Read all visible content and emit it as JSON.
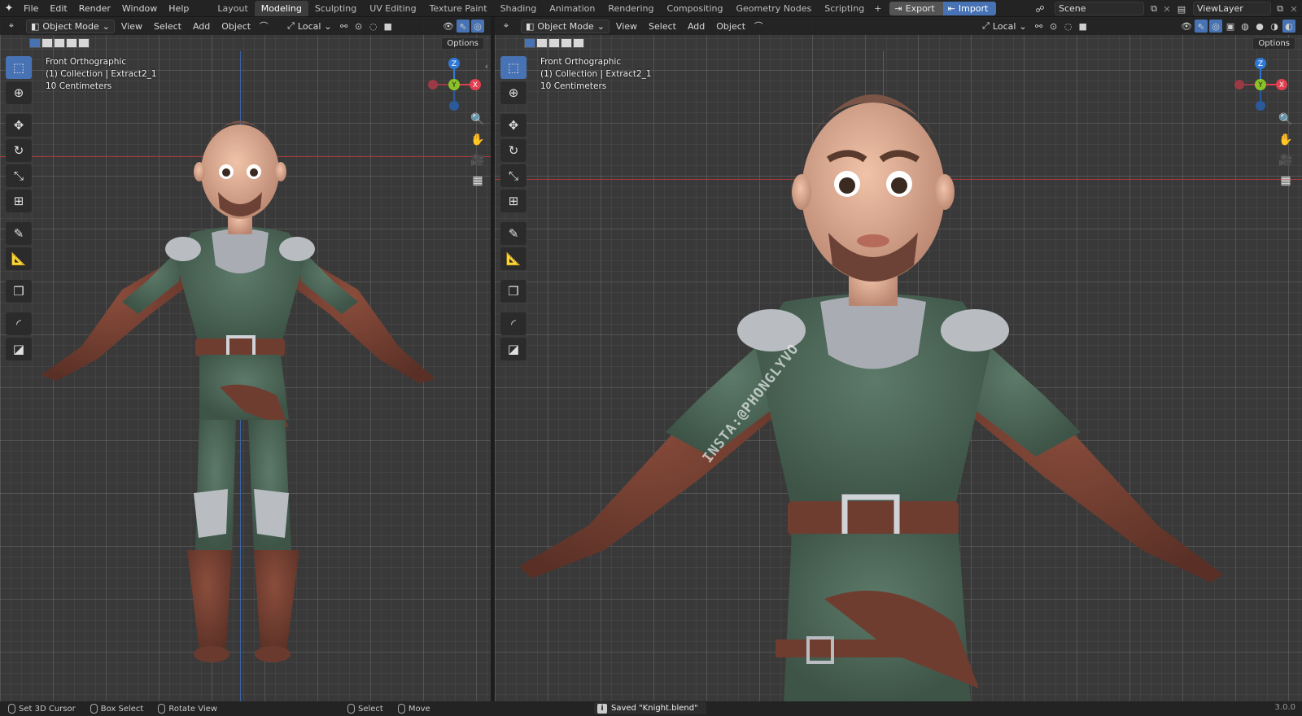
{
  "topbar": {
    "menus": [
      "File",
      "Edit",
      "Render",
      "Window",
      "Help"
    ],
    "workspaces": [
      "Layout",
      "Modeling",
      "Sculpting",
      "UV Editing",
      "Texture Paint",
      "Shading",
      "Animation",
      "Rendering",
      "Compositing",
      "Geometry Nodes",
      "Scripting"
    ],
    "active_workspace": "Modeling",
    "add_tab": "+",
    "export_label": "Export",
    "import_label": "Import",
    "scene": "Scene",
    "view_layer": "ViewLayer"
  },
  "left_viewport": {
    "mode": "Object Mode",
    "menus": [
      "View",
      "Select",
      "Add",
      "Object"
    ],
    "transform_orientation": "Local",
    "options_label": "Options",
    "overlay_lines": [
      "Front Orthographic",
      "(1) Collection | Extract2_1",
      "10 Centimeters"
    ]
  },
  "right_viewport": {
    "mode": "Object Mode",
    "menus": [
      "View",
      "Select",
      "Add",
      "Object"
    ],
    "transform_orientation": "Local",
    "options_label": "Options",
    "overlay_lines": [
      "Front Orthographic",
      "(1) Collection | Extract2_1",
      "10 Centimeters"
    ],
    "watermark": "INSTA:@PHONGLYVO"
  },
  "gizmo": {
    "z": "Z",
    "y": "Y",
    "x": "X",
    "x_color": "#e0404f",
    "y_color": "#8ac326",
    "z_color": "#2f78d8"
  },
  "statusbar": {
    "items": [
      "Set 3D Cursor",
      "Box Select",
      "Rotate View",
      "Select",
      "Move"
    ],
    "message": "Saved \"Knight.blend\"",
    "version": "3.0.0"
  },
  "colors": {
    "accent": "#4772b3",
    "tunic": "#4f6a5b",
    "leather": "#6e3d30",
    "skin": "#d9a88c",
    "metal": "#b9bdc2"
  }
}
